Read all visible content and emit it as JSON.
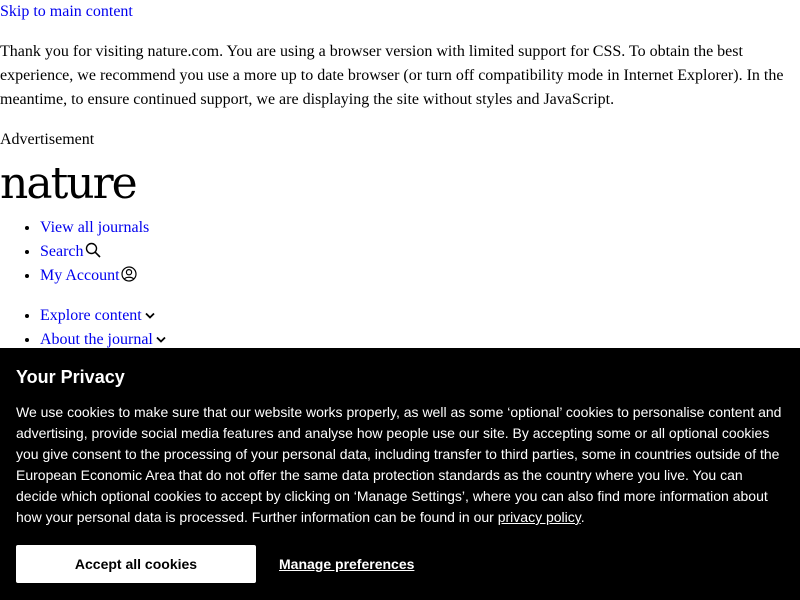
{
  "skip_link": "Skip to main content",
  "browser_notice": "Thank you for visiting nature.com. You are using a browser version with limited support for CSS. To obtain the best experience, we recommend you use a more up to date browser (or turn off compatibility mode in Internet Explorer). In the meantime, to ensure continued support, we are displaying the site without styles and JavaScript.",
  "advertisement_label": "Advertisement",
  "logo_text": "nature",
  "header_nav": {
    "view_all_journals": "View all journals",
    "search": "Search",
    "search_icon": "search-icon",
    "my_account": "My Account",
    "account_icon": "user-icon"
  },
  "main_nav": {
    "explore_content": "Explore content",
    "about_journal": "About the journal",
    "chevron_icon": "chevron-down-icon"
  },
  "cookie_banner": {
    "title": "Your Privacy",
    "body_before_link": "We use cookies to make sure that our website works properly, as well as some ‘optional’ cookies to personalise content and advertising, provide social media features and analyse how people use our site. By accepting some or all optional cookies you give consent to the processing of your personal data, including transfer to third parties, some in countries outside of the European Economic Area that do not offer the same data protection standards as the country where you live. You can decide which optional cookies to accept by clicking on ‘Manage Settings’, where you can also find more information about how your personal data is processed. Further information can be found in our ",
    "privacy_link": "privacy policy",
    "body_after_link": ".",
    "accept_button": "Accept all cookies",
    "manage_button": "Manage preferences",
    "background_color": "#000000",
    "text_color": "#ffffff"
  },
  "colors": {
    "link": "#0000ee",
    "text": "#000000",
    "background": "#ffffff"
  }
}
